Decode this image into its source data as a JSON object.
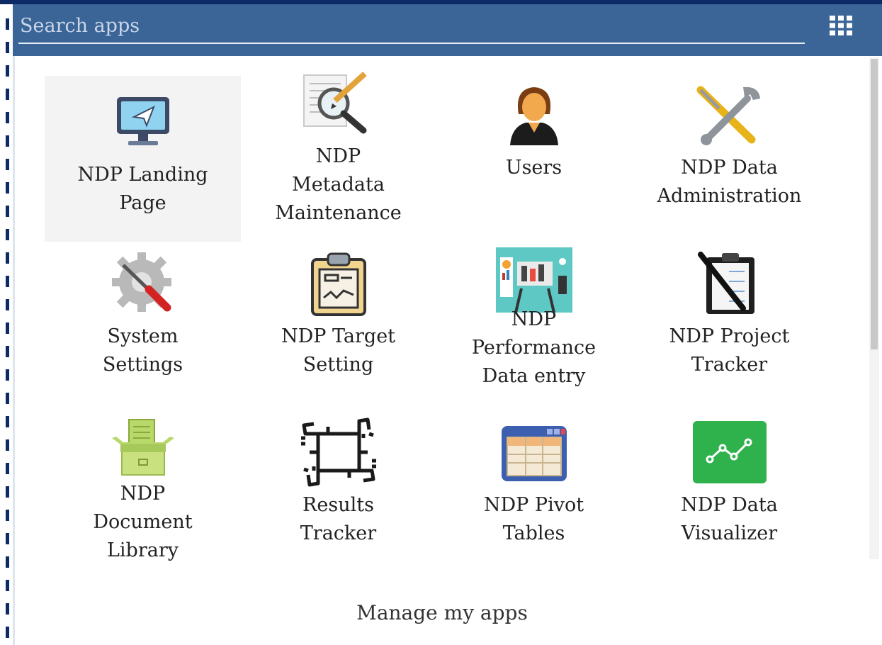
{
  "search": {
    "placeholder": "Search apps",
    "value": ""
  },
  "header": {
    "menu_icon": "apps-grid-icon"
  },
  "apps": [
    {
      "label": "NDP Landing\nPage",
      "icon": "monitor-send-icon",
      "active": true
    },
    {
      "label": "NDP\nMetadata\nMaintenance",
      "icon": "magnifier-pencil-icon"
    },
    {
      "label": "Users",
      "icon": "user-icon"
    },
    {
      "label": "NDP Data\nAdministration",
      "icon": "wrench-screwdriver-icon"
    },
    {
      "label": "System\nSettings",
      "icon": "gear-tools-icon"
    },
    {
      "label": "NDP Target\nSetting",
      "icon": "clipboard-icon"
    },
    {
      "label": "NDP\nPerformance\nData entry",
      "icon": "dashboard-icon"
    },
    {
      "label": "NDP Project\nTracker",
      "icon": "checklist-pen-icon"
    },
    {
      "label": "NDP\nDocument\nLibrary",
      "icon": "document-box-icon"
    },
    {
      "label": "Results\nTracker",
      "icon": "linked-hands-icon"
    },
    {
      "label": "NDP Pivot\nTables",
      "icon": "pivot-table-icon"
    },
    {
      "label": "NDP Data\nVisualizer",
      "icon": "line-chart-icon"
    }
  ],
  "footer": {
    "manage_label": "Manage my apps"
  },
  "colors": {
    "header_bg": "#3b6497",
    "frame": "#0d2a66",
    "visualizer_green": "#2fb24c"
  }
}
